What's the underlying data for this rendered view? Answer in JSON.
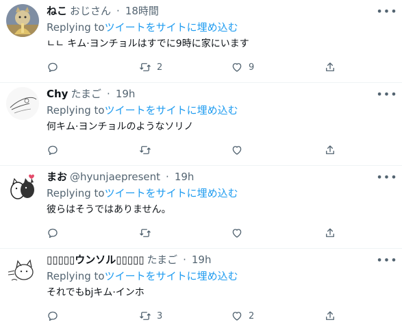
{
  "tweets": [
    {
      "name": "ねこ",
      "handle": "おじさん",
      "separator": "·",
      "time": "18時間",
      "replying_prefix": "Replying to",
      "replying_target": "ツイートをサイトに埋め込む",
      "text": "ㄴㄴ キム·ヨンチョルはすでに9時に家にいます",
      "reply_count": "",
      "retweet_count": "2",
      "like_count": "9",
      "avatar": "cat-warrior-avatar",
      "more": "•••"
    },
    {
      "name": "Chy",
      "handle": "たまご",
      "separator": "·",
      "time": "19h",
      "replying_prefix": "Replying to",
      "replying_target": "ツイートをサイトに埋め込む",
      "text": "何キム·ヨンチョルのようなソリノ",
      "reply_count": "",
      "retweet_count": "",
      "like_count": "",
      "avatar": "sketch-avatar",
      "more": "•••"
    },
    {
      "name": "まお",
      "handle": "@hyunjaepresent",
      "separator": "·",
      "time": "19h",
      "replying_prefix": "Replying to",
      "replying_target": "ツイートをサイトに埋め込む",
      "text": "彼らはそうではありません。",
      "reply_count": "",
      "retweet_count": "",
      "like_count": "",
      "avatar": "cats-hug-avatar",
      "more": "•••"
    },
    {
      "name": "▯▯▯▯▯ウンソル▯▯▯▯▯",
      "handle": "たまご",
      "separator": "·",
      "time": "19h",
      "replying_prefix": "Replying to",
      "replying_target": "ツイートをサイトに埋め込む",
      "text": "それでもbjキム·インホ",
      "reply_count": "",
      "retweet_count": "3",
      "like_count": "2",
      "avatar": "doodle-cat-avatar",
      "more": "•••"
    }
  ],
  "colors": {
    "text": "#0f1419",
    "secondary": "#536471",
    "link": "#1d9bf0",
    "divider": "#eff3f4"
  }
}
